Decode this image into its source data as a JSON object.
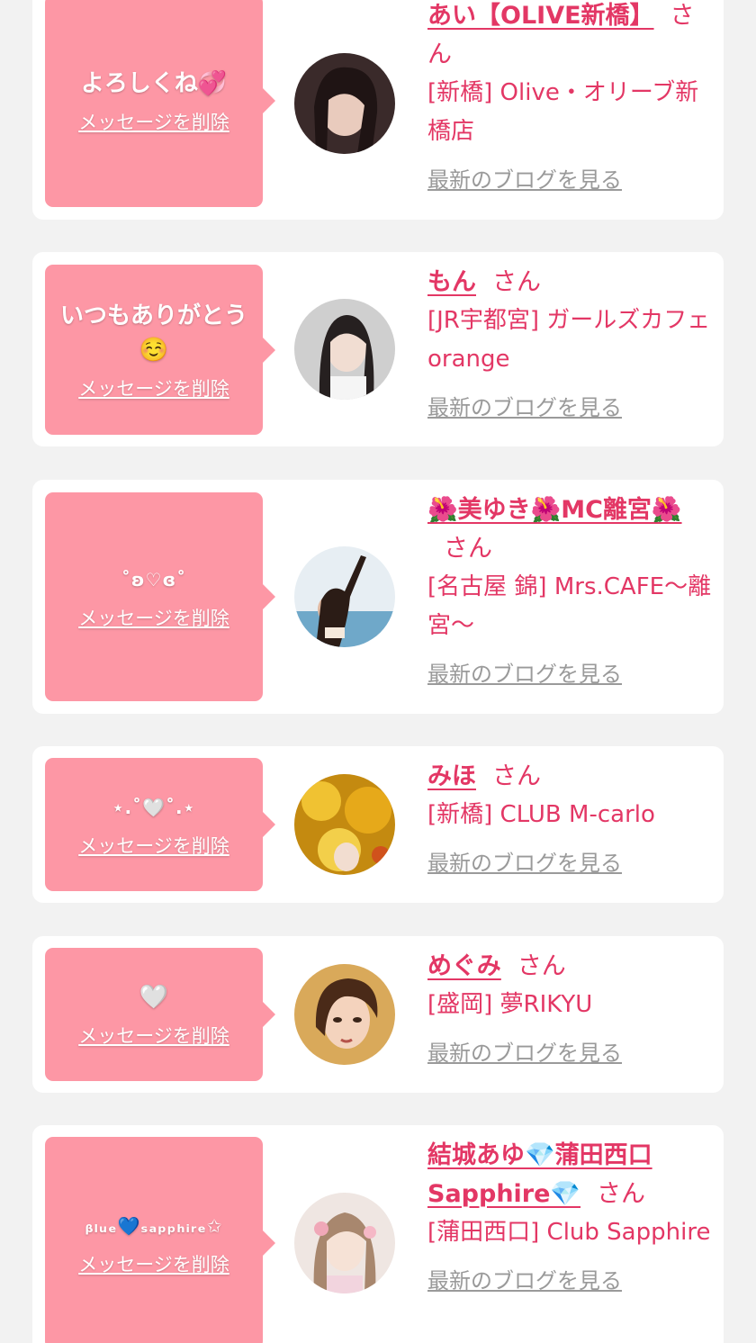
{
  "colors": {
    "bubble": "#fd97a5",
    "accent": "#e33765",
    "muted": "#9a9a9a",
    "background": "#f2f2f2",
    "card": "#ffffff"
  },
  "common": {
    "delete_label": "メッセージを削除",
    "honorific": "さん",
    "blog_label": "最新のブログを見る"
  },
  "items": [
    {
      "message": "よろしくね💞",
      "name": "あい【OLIVE新橋】",
      "shop": "[新橋] Olive・オリーブ新橋店"
    },
    {
      "message": "いつもありがとう☺️",
      "name": "もん",
      "shop": "[JR宇都宮] ガールズカフェ orange"
    },
    {
      "message": "˚ʚ♡ɞ˚",
      "name": "🌺美ゆき🌺MC離宮🌺",
      "shop": "[名古屋 錦] Mrs.CAFE〜離宮〜"
    },
    {
      "message": "⋆.˚🤍˚.⋆",
      "name": "みほ",
      "shop": "[新橋] CLUB M-carlo"
    },
    {
      "message": "🤍",
      "name": "めぐみ",
      "shop": "[盛岡] 夢RIKYU"
    },
    {
      "message": "ᵦₗᵤₑ💙ₛₐₚₚₕᵢᵣₑ✩",
      "name": "結城あゆ💎蒲田西口Sapphire💎",
      "shop": "[蒲田西口] Club Sapphire"
    }
  ]
}
